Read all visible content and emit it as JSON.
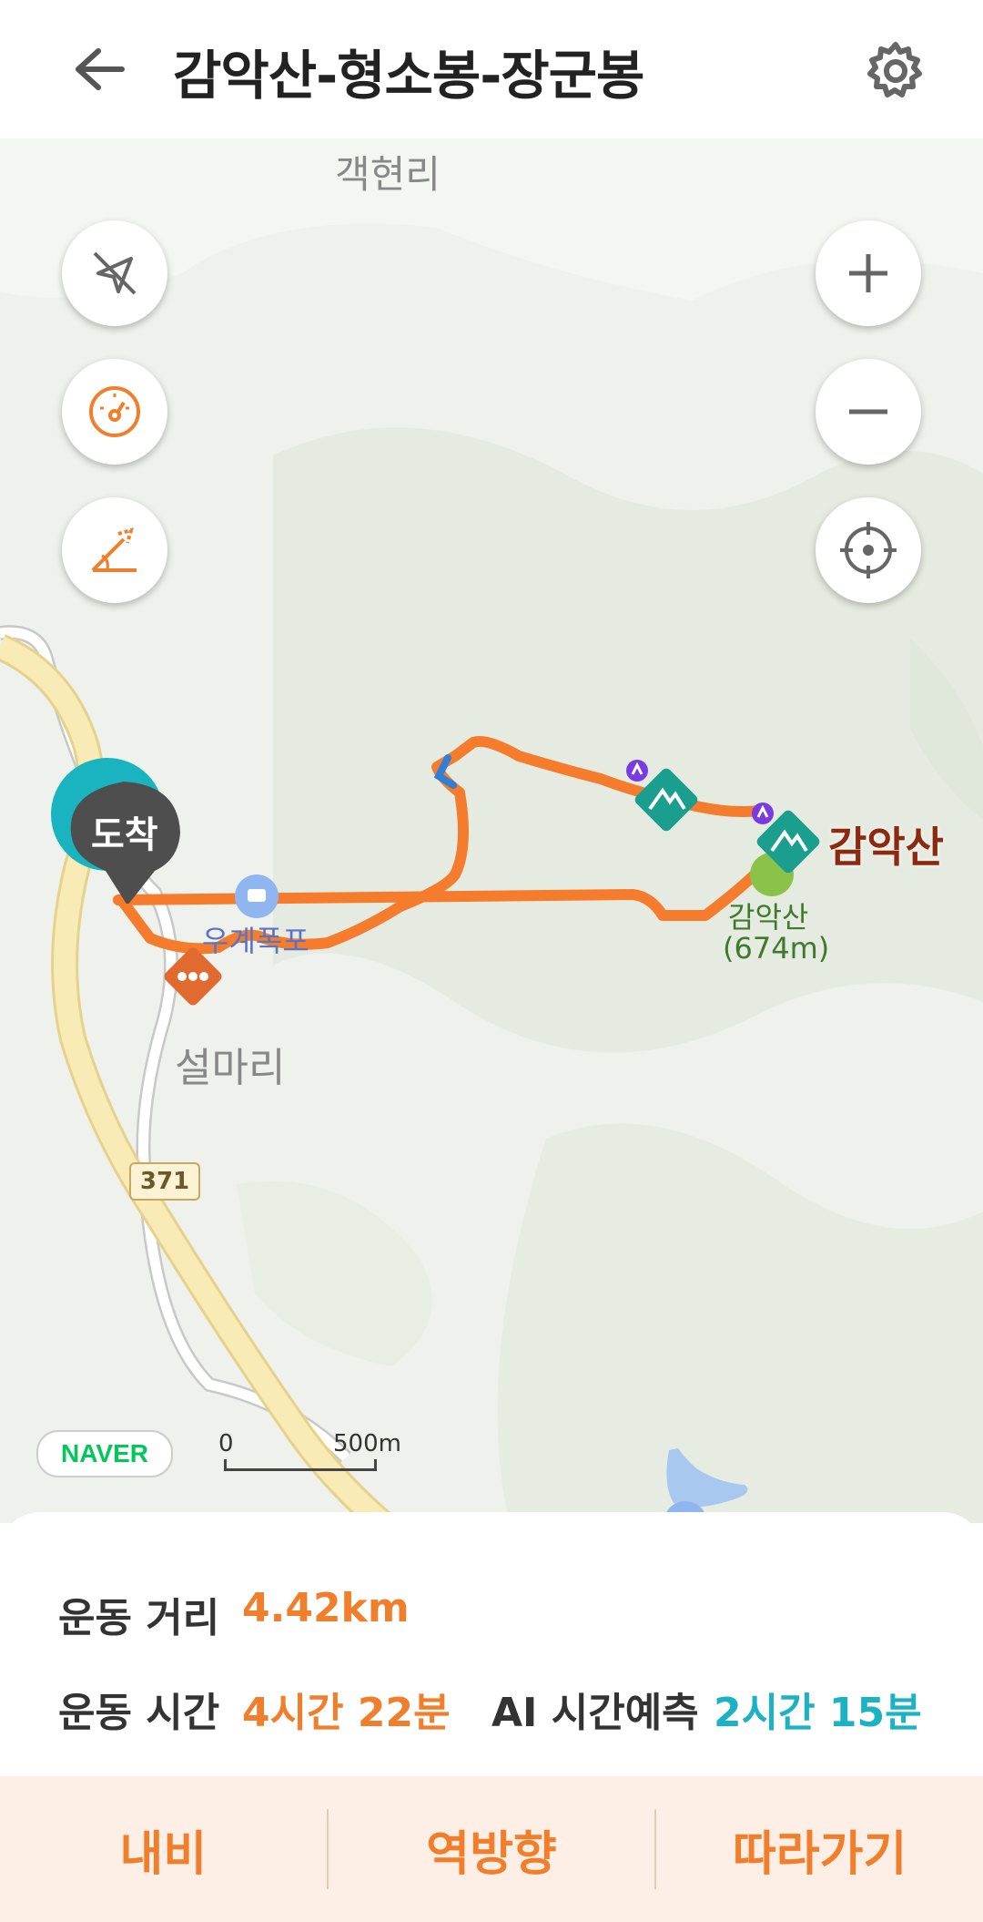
{
  "header": {
    "title": "감악산-형소봉-장군봉",
    "back_icon": "arrow-left-icon",
    "settings_icon": "gear-icon"
  },
  "map": {
    "place_labels": {
      "gaekhyeon": "객현리",
      "seolma": "설마리",
      "urepo": "우계폭포",
      "gamak_summit": "감악산",
      "gamak_peak": "감악산",
      "gamak_height": "(674m)"
    },
    "arrival_marker": "도착",
    "route_number": "371",
    "scale": {
      "zero": "0",
      "distance": "500m"
    },
    "attribution": "NAVER",
    "controls": {
      "left": [
        "compass-off-icon",
        "speedometer-icon",
        "slope-icon"
      ],
      "right": [
        "zoom-in-icon",
        "zoom-out-icon",
        "locate-icon"
      ]
    },
    "colors": {
      "route": "#f47c2c",
      "summit_marker": "#1a9e8e",
      "poi_marker": "#e06a2f"
    }
  },
  "stats": {
    "distance_label": "운동 거리",
    "distance_value": "4.42km",
    "time_label": "운동 시간",
    "time_value": "4시간 22분",
    "ai_label": "AI 시간예측",
    "ai_value": "2시간 15분",
    "accent_color": "#f07e2a",
    "ai_color": "#1bb3c4"
  },
  "actions": {
    "navi": "내비",
    "reverse": "역방향",
    "follow": "따라가기"
  }
}
